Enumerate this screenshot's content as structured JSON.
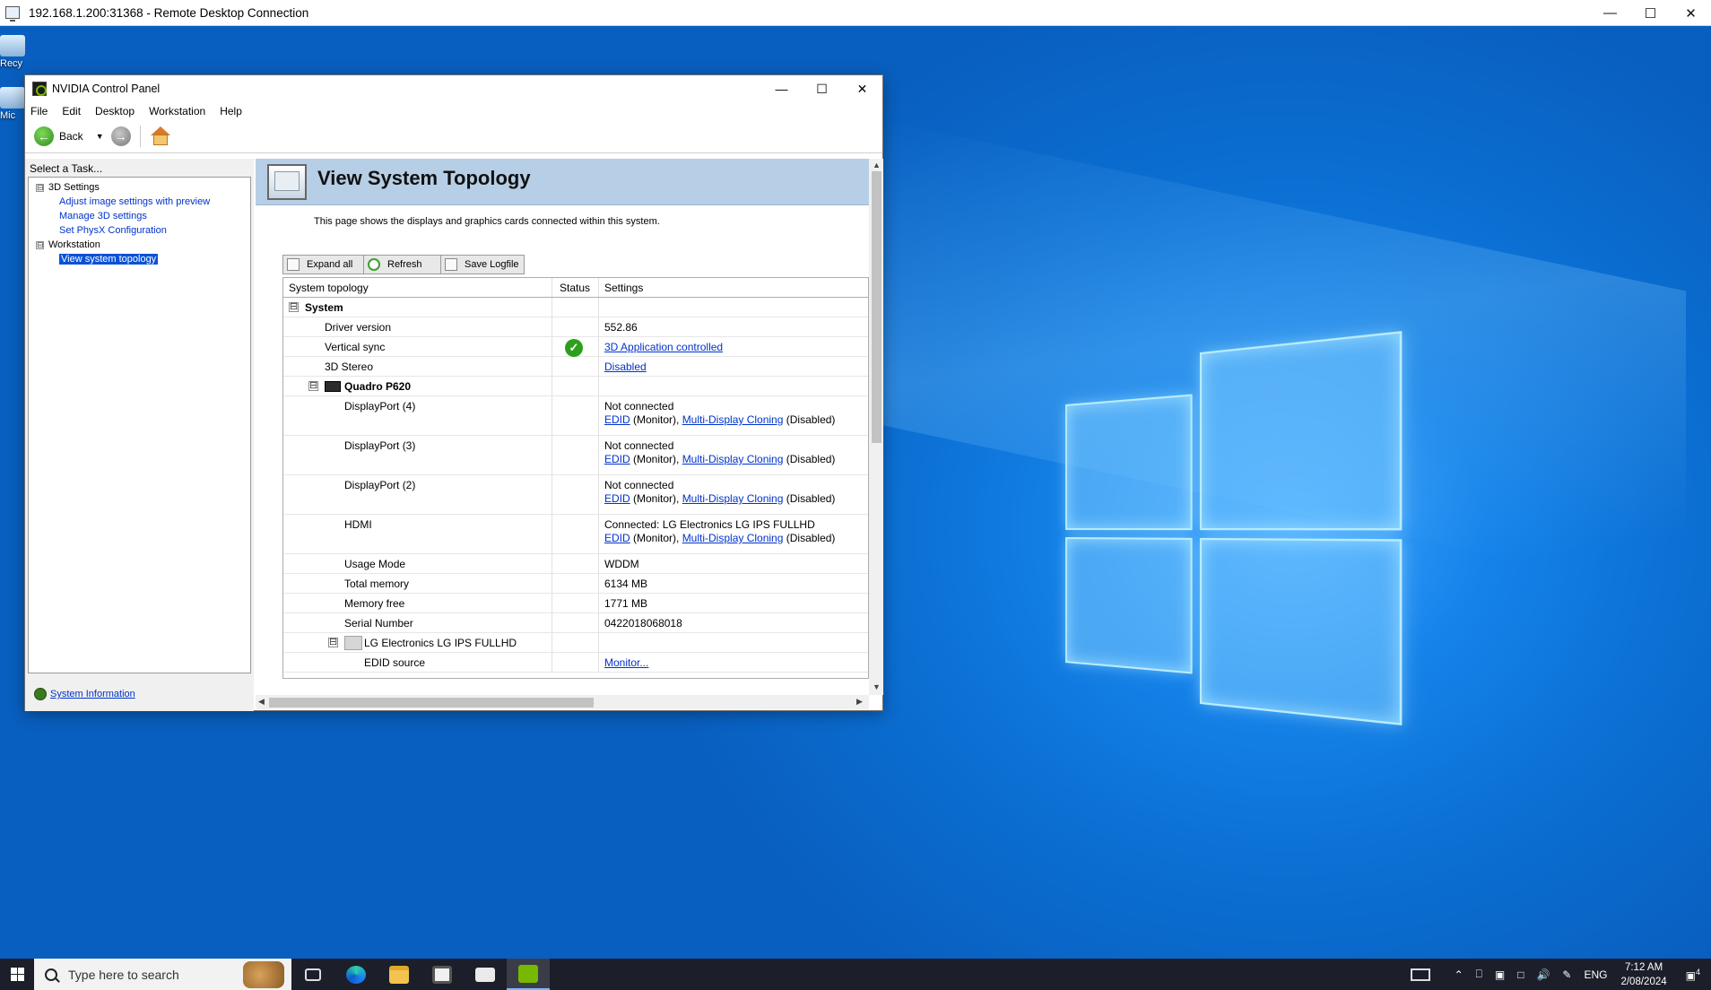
{
  "rdp": {
    "title": "192.168.1.200:31368 - Remote Desktop Connection"
  },
  "desktop": {
    "icons": [
      {
        "label": "Recy"
      },
      {
        "label": "Mic"
      }
    ]
  },
  "window": {
    "title": "NVIDIA Control Panel",
    "menu": [
      "File",
      "Edit",
      "Desktop",
      "Workstation",
      "Help"
    ],
    "back_label": "Back"
  },
  "left": {
    "header": "Select a Task...",
    "tree": [
      {
        "label": "3D Settings",
        "level": 0,
        "expander": "⊟"
      },
      {
        "label": "Adjust image settings with preview",
        "level": 1,
        "link": true
      },
      {
        "label": "Manage 3D settings",
        "level": 1,
        "link": true
      },
      {
        "label": "Set PhysX Configuration",
        "level": 1,
        "link": true
      },
      {
        "label": "Workstation",
        "level": 0,
        "expander": "⊟"
      },
      {
        "label": "View system topology",
        "level": 1,
        "selected": true
      }
    ],
    "system_info": "System Information"
  },
  "page": {
    "title": "View System Topology",
    "description": "This page shows the displays and graphics cards connected within this system.",
    "buttons": {
      "expand": "Expand all",
      "refresh": "Refresh",
      "save": "Save Logfile"
    },
    "columns": {
      "topology": "System topology",
      "status": "Status",
      "settings": "Settings"
    },
    "rows": [
      {
        "name": "System",
        "bold": true,
        "expander": "⊟",
        "level": 0
      },
      {
        "name": "Driver version",
        "level": 1,
        "settings": "552.86"
      },
      {
        "name": "Vertical sync",
        "level": 1,
        "status_ok": true,
        "link": "3D Application controlled"
      },
      {
        "name": "3D Stereo",
        "level": 1,
        "link": "Disabled"
      },
      {
        "name": "Quadro P620",
        "bold": true,
        "expander": "⊟",
        "level": 1,
        "icon": "gpu-icon"
      },
      {
        "name": "DisplayPort (4)",
        "level": 2,
        "settings": "Not connected",
        "tall": true,
        "edid": "EDID",
        "monitor": " (Monitor), ",
        "mdc": "Multi-Display Cloning",
        "dis": " (Disabled)"
      },
      {
        "name": "DisplayPort (3)",
        "level": 2,
        "settings": "Not connected",
        "tall": true,
        "edid": "EDID",
        "monitor": " (Monitor), ",
        "mdc": "Multi-Display Cloning",
        "dis": " (Disabled)"
      },
      {
        "name": "DisplayPort (2)",
        "level": 2,
        "settings": "Not connected",
        "tall": true,
        "edid": "EDID",
        "monitor": " (Monitor), ",
        "mdc": "Multi-Display Cloning",
        "dis": " (Disabled)"
      },
      {
        "name": "HDMI",
        "level": 2,
        "settings": "Connected: LG Electronics LG IPS FULLHD",
        "tall": true,
        "edid": "EDID",
        "monitor": " (Monitor), ",
        "mdc": "Multi-Display Cloning",
        "dis": " (Disabled)"
      },
      {
        "name": "Usage Mode",
        "level": 2,
        "settings": "WDDM"
      },
      {
        "name": "Total memory",
        "level": 2,
        "settings": "6134 MB"
      },
      {
        "name": "Memory free",
        "level": 2,
        "settings": "1771 MB"
      },
      {
        "name": "Serial Number",
        "level": 2,
        "settings": "0422018068018"
      },
      {
        "name": "LG Electronics LG IPS FULLHD",
        "level": 2,
        "expander": "⊟",
        "icon": "monitor-icon"
      },
      {
        "name": "EDID source",
        "level": 3,
        "link": "Monitor..."
      }
    ]
  },
  "taskbar": {
    "search_placeholder": "Type here to search",
    "lang": "ENG",
    "time": "7:12 AM",
    "date": "2/08/2024",
    "notifications": "4"
  }
}
